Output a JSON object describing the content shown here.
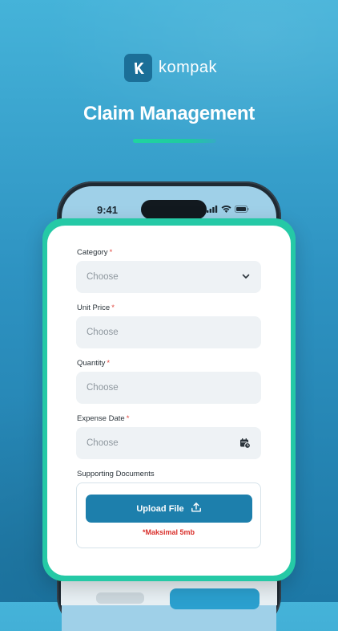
{
  "brand": {
    "name": "kompak",
    "logo_letter": "K"
  },
  "title": "Claim Management",
  "status_bar": {
    "time": "9:41"
  },
  "form": {
    "category": {
      "label": "Category",
      "required_mark": "*",
      "placeholder": "Choose"
    },
    "unit_price": {
      "label": "Unit Price",
      "required_mark": "*",
      "placeholder": "Choose"
    },
    "quantity": {
      "label": "Quantity",
      "required_mark": "*",
      "placeholder": "Choose"
    },
    "expense_date": {
      "label": "Expense Date",
      "required_mark": "*",
      "placeholder": "Choose"
    },
    "supporting_documents": {
      "label": "Supporting Documents",
      "upload_label": "Upload File",
      "note": "*Maksimal 5mb"
    }
  },
  "colors": {
    "primary": "#1d7fac",
    "accent": "#25c9a6",
    "required": "#e0473f",
    "input_bg": "#eef2f5"
  }
}
